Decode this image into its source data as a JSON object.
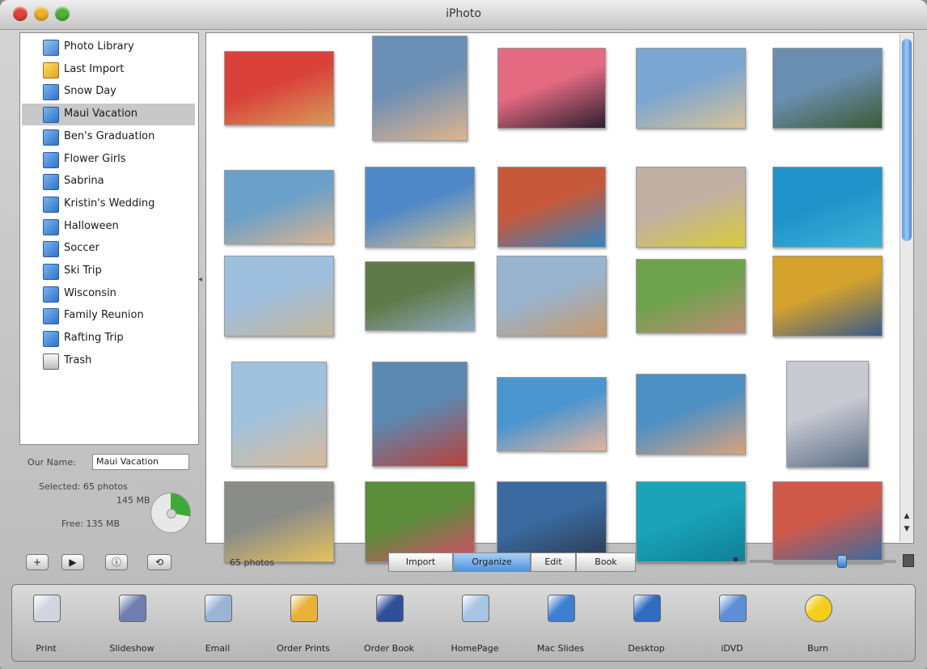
{
  "window": {
    "title": "iPhoto"
  },
  "sidebar": {
    "items": [
      {
        "label": "Photo Library",
        "icon": "photo-library-icon"
      },
      {
        "label": "Last Import",
        "icon": "last-import-icon"
      },
      {
        "label": "Snow Day",
        "icon": "album-icon"
      },
      {
        "label": "Maui Vacation",
        "icon": "album-icon",
        "selected": true
      },
      {
        "label": "Ben's Graduation",
        "icon": "album-icon"
      },
      {
        "label": "Flower Girls",
        "icon": "album-icon"
      },
      {
        "label": "Sabrina",
        "icon": "album-icon"
      },
      {
        "label": "Kristin's Wedding",
        "icon": "album-icon"
      },
      {
        "label": "Halloween",
        "icon": "album-icon"
      },
      {
        "label": "Soccer",
        "icon": "album-icon"
      },
      {
        "label": "Ski Trip",
        "icon": "album-icon"
      },
      {
        "label": "Wisconsin",
        "icon": "album-icon"
      },
      {
        "label": "Family Reunion",
        "icon": "album-icon"
      },
      {
        "label": "Rafting Trip",
        "icon": "album-icon"
      },
      {
        "label": "Trash",
        "icon": "trash-icon"
      }
    ]
  },
  "info": {
    "album_name_label": "Our Name:",
    "album_name_value": "Maui Vacation",
    "selected_label": "Selected: 65 photos",
    "selected_size": "145 MB",
    "free_label": "Free: 135 MB"
  },
  "controls": {
    "buttons": [
      {
        "glyph": "+",
        "icon": "add-album-icon"
      },
      {
        "glyph": "▶",
        "icon": "play-slideshow-icon"
      },
      {
        "glyph": "ⓘ",
        "icon": "info-icon"
      },
      {
        "glyph": "⟲",
        "icon": "rotate-icon"
      }
    ],
    "photo_count": "65 photos",
    "mode_tabs": [
      {
        "label": "Import",
        "active": false
      },
      {
        "label": "Organize",
        "active": true
      },
      {
        "label": "Edit",
        "active": false
      },
      {
        "label": "Book",
        "active": false
      }
    ],
    "zoom_level": 0.63
  },
  "tools": [
    {
      "label": "Print",
      "icon": "printer-icon",
      "color": "#cfd6df"
    },
    {
      "label": "Slideshow",
      "icon": "slideshow-icon",
      "color": "#6e7fb0"
    },
    {
      "label": "Email",
      "icon": "email-icon",
      "color": "#9ab4d6"
    },
    {
      "label": "Order Prints",
      "icon": "order-prints-icon",
      "color": "#e8b23a"
    },
    {
      "label": "Order Book",
      "icon": "order-book-icon",
      "color": "#2f4f9a"
    },
    {
      "label": "HomePage",
      "icon": "homepage-icon",
      "color": "#a6c4e4"
    },
    {
      "label": "Mac Slides",
      "icon": "mac-slides-icon",
      "color": "#3d7fd0"
    },
    {
      "label": "Desktop",
      "icon": "desktop-icon",
      "color": "#2f6cc0"
    },
    {
      "label": "iDVD",
      "icon": "idvd-icon",
      "color": "#5d8fd6"
    },
    {
      "label": "Burn",
      "icon": "burn-icon",
      "color": "#f1cf1a"
    }
  ],
  "photos": [
    {
      "name": "kids-group",
      "colors": [
        "#d9413a",
        "#d79a5a"
      ]
    },
    {
      "name": "family-portrait",
      "colors": [
        "#6b8fb5",
        "#e0b48c"
      ]
    },
    {
      "name": "sunset-palms",
      "colors": [
        "#e46a82",
        "#2b2030"
      ]
    },
    {
      "name": "surfers-beach",
      "colors": [
        "#7aa6d1",
        "#d9c295"
      ]
    },
    {
      "name": "rainbow-coast",
      "colors": [
        "#6a8fb0",
        "#3d5a35"
      ]
    },
    {
      "name": "beach-family",
      "colors": [
        "#6aa0c9",
        "#d8b48e"
      ]
    },
    {
      "name": "sandy-shore",
      "colors": [
        "#4f88c8",
        "#d8c08e"
      ]
    },
    {
      "name": "kids-smile",
      "colors": [
        "#c6583a",
        "#2f85c4"
      ]
    },
    {
      "name": "boy-in-sand",
      "colors": [
        "#c0b0a4",
        "#d8cc3a"
      ]
    },
    {
      "name": "snorkel-swim",
      "colors": [
        "#1f93c9",
        "#3bb2d8"
      ]
    },
    {
      "name": "beach-cabana",
      "colors": [
        "#9fbfdf",
        "#c5b69a"
      ]
    },
    {
      "name": "green-field",
      "colors": [
        "#5f7a48",
        "#8fa8c0"
      ]
    },
    {
      "name": "family-standing",
      "colors": [
        "#98b4cf",
        "#c89a6e"
      ]
    },
    {
      "name": "kids-on-grass",
      "colors": [
        "#6ea34d",
        "#c08a76"
      ]
    },
    {
      "name": "leis-family",
      "colors": [
        "#d4a22d",
        "#3a5a8a"
      ]
    },
    {
      "name": "couple-beach",
      "colors": [
        "#9fc3df",
        "#d8b898"
      ]
    },
    {
      "name": "kids-waves",
      "colors": [
        "#5c89b2",
        "#b8423a"
      ]
    },
    {
      "name": "girl-sunbathing",
      "colors": [
        "#4a95d0",
        "#e6b49a"
      ]
    },
    {
      "name": "boy-splash",
      "colors": [
        "#4d90c4",
        "#d9a37a"
      ]
    },
    {
      "name": "wave-splash",
      "colors": [
        "#c9c9d2",
        "#5c6f86"
      ]
    },
    {
      "name": "sandcastle",
      "colors": [
        "#8a8c8a",
        "#e5c25a"
      ]
    },
    {
      "name": "flower-group",
      "colors": [
        "#5a8c3a",
        "#d94a6a"
      ]
    },
    {
      "name": "wetsuit-portrait",
      "colors": [
        "#3a6aa0",
        "#2b3a4e"
      ]
    },
    {
      "name": "underwater-swim",
      "colors": [
        "#1aa3b9",
        "#0f7f96"
      ]
    },
    {
      "name": "leis-couple",
      "colors": [
        "#d05a4a",
        "#3b6aa0"
      ]
    }
  ]
}
